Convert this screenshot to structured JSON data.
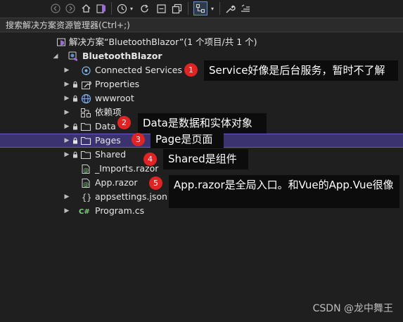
{
  "toolbar": {
    "icons": [
      "back-icon",
      "forward-icon",
      "home-icon",
      "vs-switch-icon",
      "history-icon",
      "dropdown-icon",
      "refresh-icon",
      "collapse-all-icon",
      "copy-icon",
      "show-all-icon",
      "dropdown-icon",
      "wrench-icon",
      "preview-icon"
    ]
  },
  "search": {
    "placeholder": "搜索解决方案资源管理器(Ctrl+;)"
  },
  "tree": {
    "solution": {
      "label": "解决方案“BluetoothBlazor”(1 个项目/共 1 个)"
    },
    "project": {
      "label": "BluetoothBlazor"
    },
    "items": [
      {
        "label": "Connected Services",
        "icon": "connected-services-icon"
      },
      {
        "label": "Properties",
        "icon": "wrench-icon"
      },
      {
        "label": "wwwroot",
        "icon": "globe-icon"
      },
      {
        "label": "依赖项",
        "icon": "dependencies-icon"
      },
      {
        "label": "Data",
        "icon": "folder-icon"
      },
      {
        "label": "Pages",
        "icon": "folder-icon"
      },
      {
        "label": "Shared",
        "icon": "folder-icon"
      },
      {
        "label": "_Imports.razor",
        "icon": "razor-file-icon"
      },
      {
        "label": "App.razor",
        "icon": "razor-file-icon"
      },
      {
        "label": "appsettings.json",
        "icon": "json-file-icon"
      },
      {
        "label": "Program.cs",
        "icon": "csharp-file-icon"
      }
    ]
  },
  "annotations": [
    {
      "number": "1",
      "text": "Service好像是后台服务，暂时不了解"
    },
    {
      "number": "2",
      "text": "Data是数据和实体对象"
    },
    {
      "number": "3",
      "text": "Page是页面"
    },
    {
      "number": "4",
      "text": "Shared是组件"
    },
    {
      "number": "5",
      "text": "App.razor是全局入口。和Vue的App.Vue很像"
    }
  ],
  "watermark": "CSDN @龙中舞王",
  "colors": {
    "selected_row": "#3a3370",
    "badge": "#e02424",
    "note_bg": "#0c0c0c",
    "background": "#1f1f1f"
  }
}
